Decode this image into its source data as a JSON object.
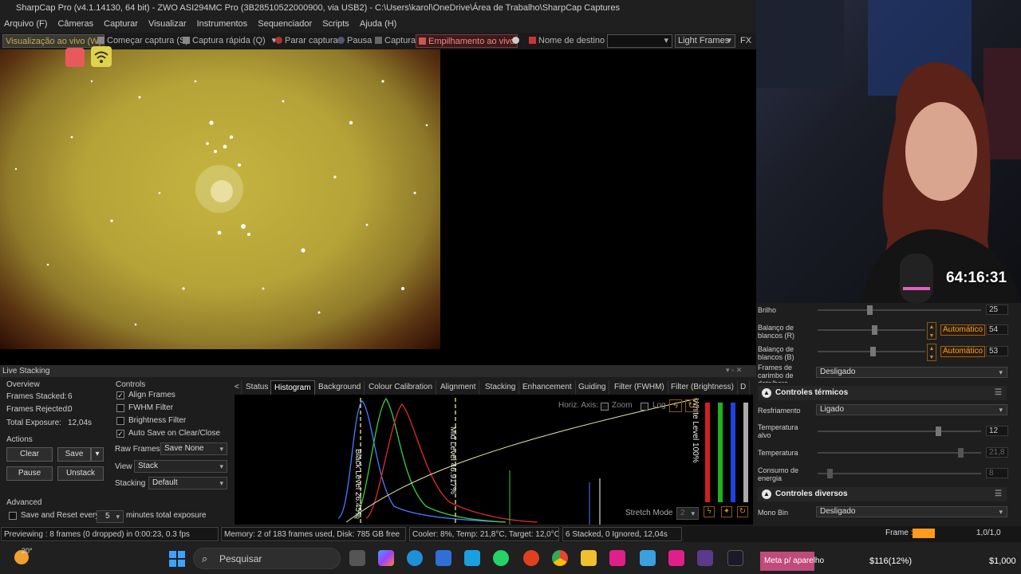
{
  "window": {
    "title": "SharpCap Pro (v4.1.14130, 64 bit) - ZWO ASI294MC Pro (3B28510522000900, via USB2) - C:\\Users\\karol\\OneDrive\\Área de Trabalho\\SharpCap Captures"
  },
  "menu": [
    "Arquivo (F)",
    "Câmeras",
    "Capturar",
    "Visualizar",
    "Instrumentos",
    "Sequenciador",
    "Scripts",
    "Ajuda (H)"
  ],
  "toolbar": {
    "live": "Visualização ao vivo (W)",
    "start_capture": "Começar captura (S)",
    "quick_capture": "Captura rápida (Q)",
    "stop_capture": "Parar captura",
    "pause": "Pausa",
    "capture": "Captura",
    "live_stacking": "Empilhamento ao vivo",
    "target_name": "Nome de destino",
    "frame_type": "Light Frames",
    "fx": "FX"
  },
  "live_stacking": {
    "title": "Live Stacking",
    "controls_title": "Controls",
    "overview_title": "Overview",
    "frames_stacked_label": "Frames Stacked:",
    "frames_stacked": "6",
    "frames_rejected_label": "Frames Rejected:",
    "frames_rejected": "0",
    "total_exposure_label": "Total Exposure:",
    "total_exposure": "12,04s",
    "actions_title": "Actions",
    "clear": "Clear",
    "save": "Save",
    "pause": "Pause",
    "unstack": "Unstack",
    "align_frames": "Align Frames",
    "fwhm_filter": "FWHM Filter",
    "brightness_filter": "Brightness Filter",
    "auto_save": "Auto Save on Clear/Close",
    "raw_frames_label": "Raw Frames",
    "raw_frames_value": "Save None",
    "view_label": "View",
    "view_value": "Stack",
    "stacking_label": "Stacking",
    "stacking_value": "Default",
    "advanced_title": "Advanced",
    "save_reset_label": "Save and Reset every",
    "save_reset_value": "5",
    "save_reset_suffix": "minutes total exposure",
    "tabs": [
      "Status",
      "Histogram",
      "Background",
      "Colour Calibration",
      "Alignment",
      "Stacking",
      "Enhancement",
      "Guiding",
      "Filter (FWHM)",
      "Filter (Brightness)",
      "D"
    ],
    "histogram": {
      "horiz_axis": "Horiz. Axis:",
      "zoom": "Zoom",
      "log": "Log",
      "black_level": "Black Level 26.45%",
      "mid_level": "Mid Level 46.917%",
      "white_level": "White Level 100%",
      "stretch_mode": "Stretch Mode",
      "stretch_value": "2"
    }
  },
  "status": {
    "preview": "Previewing : 8 frames (0 dropped) in 0:00:23, 0.3 fps",
    "memory": "Memory: 2 of 183 frames used, Disk: 785 GB free",
    "cooler": "Cooler: 8%, Temp: 21,8°C, Target: 12,0°C",
    "stacked": "6 Stacked, 0 Ignored, 12,04s"
  },
  "stream": {
    "timer": "64:16:31"
  },
  "controls": {
    "brilho_label": "Brilho",
    "brilho": "25",
    "wb_r_label": "Balanço de blancos (R)",
    "wb_r": "54",
    "wb_b_label": "Balanço de blancos (B)",
    "wb_b": "53",
    "auto": "Automático",
    "carimbo_label": "Frames de carimbo de data/hora",
    "carimbo": "Desligado",
    "thermal_title": "Controles térmicos",
    "resfriamento_label": "Resfriamento",
    "resfriamento": "Ligado",
    "temp_alvo_label": "Temperatura alvo",
    "temp_alvo": "12",
    "temperatura_label": "Temperatura",
    "temperatura": "21,8",
    "consumo_label": "Consumo de energia",
    "consumo": "8",
    "misc_title": "Controles diversos",
    "mono_bin_label": "Mono Bin",
    "mono_bin": "Desligado",
    "frame_label": "Frame :",
    "frame_value": "1,0/1,0"
  },
  "taskbar": {
    "weather": "20°",
    "search": "Pesquisar",
    "meta": "Meta p/ aparelho",
    "money": "$116(12%)",
    "goal": "$1,000"
  }
}
